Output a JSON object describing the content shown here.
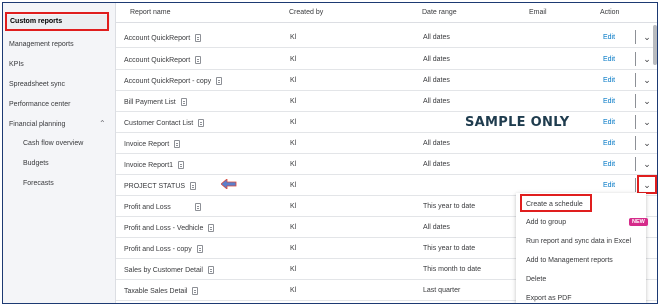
{
  "sidebar": {
    "items": [
      {
        "label": "Custom reports"
      },
      {
        "label": "Management reports"
      },
      {
        "label": "KPIs"
      },
      {
        "label": "Spreadsheet sync"
      },
      {
        "label": "Performance center"
      },
      {
        "label": "Financial planning"
      },
      {
        "label": "Cash flow overview"
      },
      {
        "label": "Budgets"
      },
      {
        "label": "Forecasts"
      }
    ]
  },
  "table": {
    "headers": {
      "name": "Report name",
      "created_by": "Created by",
      "date_range": "Date range",
      "email": "Email",
      "action": "Action"
    },
    "rows": [
      {
        "name": "Account QuickReport",
        "created_by": "Kl",
        "date_range": "All dates",
        "action": "Edit"
      },
      {
        "name": "Account QuickReport",
        "created_by": "Kl",
        "date_range": "All dates",
        "action": "Edit"
      },
      {
        "name": "Account QuickReport - copy",
        "created_by": "Kl",
        "date_range": "All dates",
        "action": "Edit"
      },
      {
        "name": "Bill Payment List",
        "created_by": "Kl",
        "date_range": "All dates",
        "action": "Edit"
      },
      {
        "name": "Customer Contact List",
        "created_by": "Kl",
        "date_range": "",
        "action": "Edit"
      },
      {
        "name": "Invoice Report",
        "created_by": "Kl",
        "date_range": "All dates",
        "action": "Edit"
      },
      {
        "name": "Invoice Report1",
        "created_by": "Kl",
        "date_range": "All dates",
        "action": "Edit"
      },
      {
        "name": "PROJECT STATUS",
        "created_by": "Kl",
        "date_range": "",
        "action": "Edit"
      },
      {
        "name": "Profit and Loss",
        "created_by": "Kl",
        "date_range": "This year to date",
        "action": ""
      },
      {
        "name": "Profit and Loss - Vedhicle",
        "created_by": "Kl",
        "date_range": "All dates",
        "action": ""
      },
      {
        "name": "Profit and Loss - copy",
        "created_by": "Kl",
        "date_range": "This year to date",
        "action": ""
      },
      {
        "name": "Sales by Customer Detail",
        "created_by": "Kl",
        "date_range": "This month to date",
        "action": ""
      },
      {
        "name": "Taxable Sales Detail",
        "created_by": "Kl",
        "date_range": "Last quarter",
        "action": ""
      }
    ]
  },
  "watermark": "SAMPLE ONLY",
  "menu": {
    "items": [
      {
        "label": "Create a schedule"
      },
      {
        "label": "Add to group"
      },
      {
        "label": "Run report and sync data in Excel"
      },
      {
        "label": "Add to Management reports"
      },
      {
        "label": "Delete"
      },
      {
        "label": "Export as PDF"
      }
    ],
    "new_badge": "NEW"
  },
  "colors": {
    "link": "#0077c5",
    "highlight": "#e01e1e",
    "badge": "#d52b8a"
  }
}
